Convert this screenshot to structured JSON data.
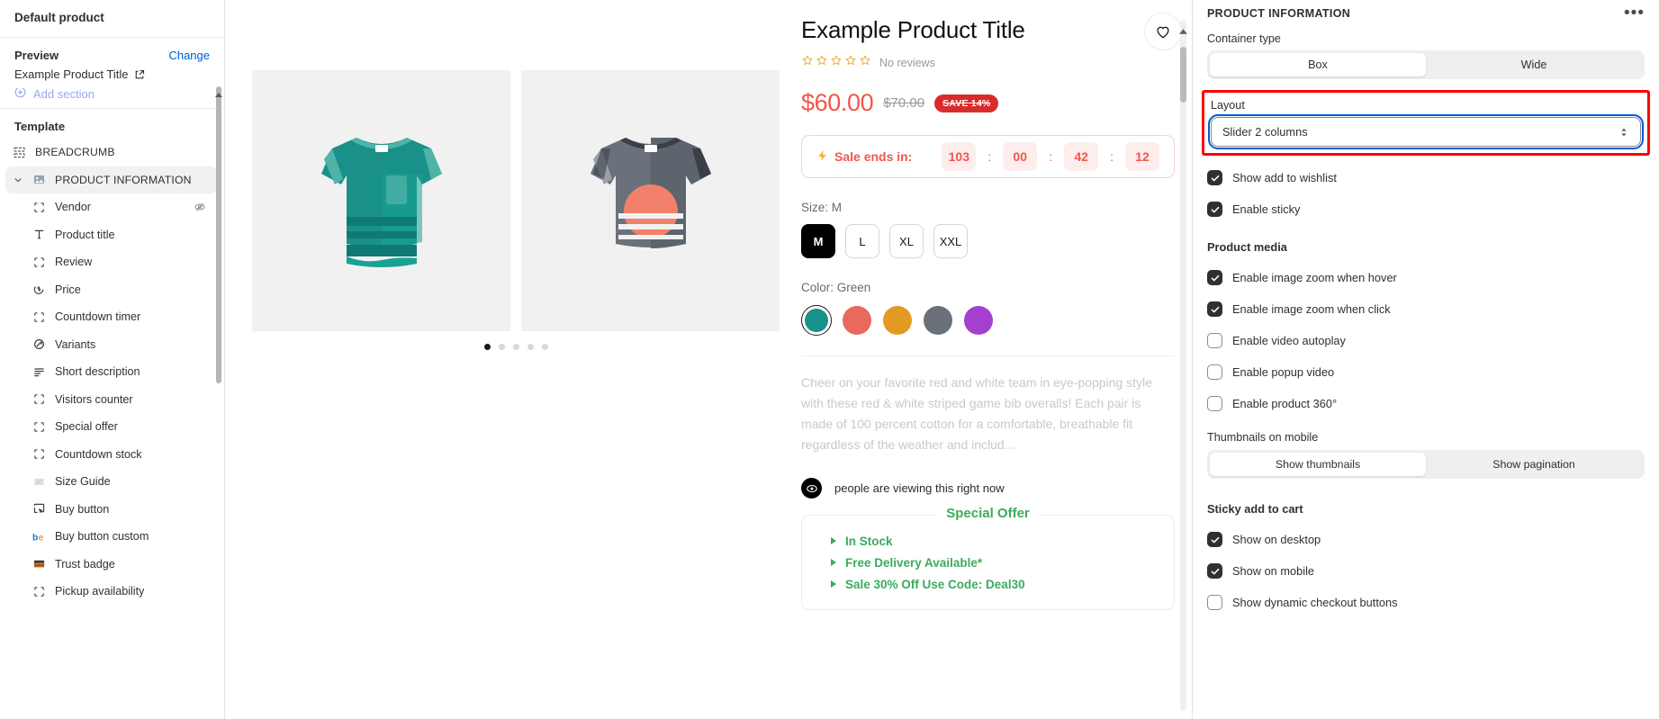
{
  "sidebar": {
    "title": "Default product",
    "preview": {
      "label": "Preview",
      "change": "Change",
      "value": "Example Product Title"
    },
    "add_section": "Add section",
    "template_label": "Template",
    "items": [
      {
        "label": "BREADCRUMB",
        "icon": "sections-icon",
        "level": "section"
      },
      {
        "label": "PRODUCT INFORMATION",
        "icon": "product-icon",
        "level": "section",
        "active": true,
        "expanded": true
      },
      {
        "label": "Vendor",
        "icon": "block-icon",
        "level": "child",
        "hidden": true
      },
      {
        "label": "Product title",
        "icon": "text-icon",
        "level": "child"
      },
      {
        "label": "Review",
        "icon": "block-icon",
        "level": "child"
      },
      {
        "label": "Price",
        "icon": "price-tag-icon",
        "level": "child"
      },
      {
        "label": "Countdown timer",
        "icon": "block-icon",
        "level": "child"
      },
      {
        "label": "Variants",
        "icon": "variants-icon",
        "level": "child"
      },
      {
        "label": "Short description",
        "icon": "text-lines-icon",
        "level": "child"
      },
      {
        "label": "Visitors counter",
        "icon": "block-icon",
        "level": "child"
      },
      {
        "label": "Special offer",
        "icon": "block-icon",
        "level": "child"
      },
      {
        "label": "Countdown stock",
        "icon": "block-icon",
        "level": "child"
      },
      {
        "label": "Size Guide",
        "icon": "size-guide-icon",
        "level": "child"
      },
      {
        "label": "Buy button",
        "icon": "cursor-button-icon",
        "level": "child"
      },
      {
        "label": "Buy button custom",
        "icon": "be-logo-icon",
        "level": "child"
      },
      {
        "label": "Trust badge",
        "icon": "trust-badge-icon",
        "level": "child"
      },
      {
        "label": "Pickup availability",
        "icon": "block-icon",
        "level": "child"
      }
    ]
  },
  "preview": {
    "product": {
      "title": "Example Product Title",
      "reviews_text": "No reviews",
      "stars": 5,
      "price": "$60.00",
      "compare_price": "$70.00",
      "save_badge": "SAVE 14%",
      "wishlist_icon": "heart-icon"
    },
    "countdown": {
      "label": "Sale ends in:",
      "bolt_icon": "lightning-icon",
      "values": [
        "103",
        "00",
        "42",
        "12"
      ],
      "separator": ":"
    },
    "size": {
      "label": "Size:",
      "selected": "M",
      "options": [
        "M",
        "L",
        "XL",
        "XXL"
      ]
    },
    "color": {
      "label": "Color:",
      "selected": "Green",
      "swatches": [
        "#1a9188",
        "#e8695e",
        "#e39a22",
        "#6b717a",
        "#a540ce"
      ]
    },
    "description": "Cheer on your favorite red and white team in eye-popping style with these red & white striped game bib overalls! Each pair is made of 100 percent cotton for a comfortable, breathable fit regardless of the weather and includ...",
    "viewers_text": "people are viewing this right now",
    "viewers_icon": "eye-icon",
    "special_offer": {
      "title": "Special Offer",
      "items": [
        "In Stock",
        "Free Delivery Available*",
        "Sale 30% Off Use Code: Deal30"
      ]
    },
    "gallery": {
      "dots": 5,
      "active_dot": 0
    }
  },
  "right_panel": {
    "title": "PRODUCT INFORMATION",
    "menu_icon": "more-horizontal-icon",
    "container_type": {
      "label": "Container type",
      "options": [
        "Box",
        "Wide"
      ],
      "selected": "Box"
    },
    "layout": {
      "label": "Layout",
      "value": "Slider 2 columns",
      "caret_icon": "chevron-updown-icon",
      "highlight_color": "#ff0000",
      "focus_color": "#005bd3"
    },
    "checkboxes_top": [
      {
        "label": "Show add to wishlist",
        "checked": true
      },
      {
        "label": "Enable sticky",
        "checked": true
      }
    ],
    "product_media": {
      "heading": "Product media",
      "checkboxes": [
        {
          "label": "Enable image zoom when hover",
          "checked": true
        },
        {
          "label": "Enable image zoom when click",
          "checked": true
        },
        {
          "label": "Enable video autoplay",
          "checked": false
        },
        {
          "label": "Enable popup video",
          "checked": false
        },
        {
          "label": "Enable product 360°",
          "checked": false
        }
      ],
      "thumbnails_label": "Thumbnails on mobile",
      "thumbnails_options": [
        "Show thumbnails",
        "Show pagination"
      ],
      "thumbnails_selected": "Show thumbnails"
    },
    "sticky_add_to_cart": {
      "heading": "Sticky add to cart",
      "checkboxes": [
        {
          "label": "Show on desktop",
          "checked": true
        },
        {
          "label": "Show on mobile",
          "checked": true
        },
        {
          "label": "Show dynamic checkout buttons",
          "checked": false
        }
      ]
    }
  }
}
